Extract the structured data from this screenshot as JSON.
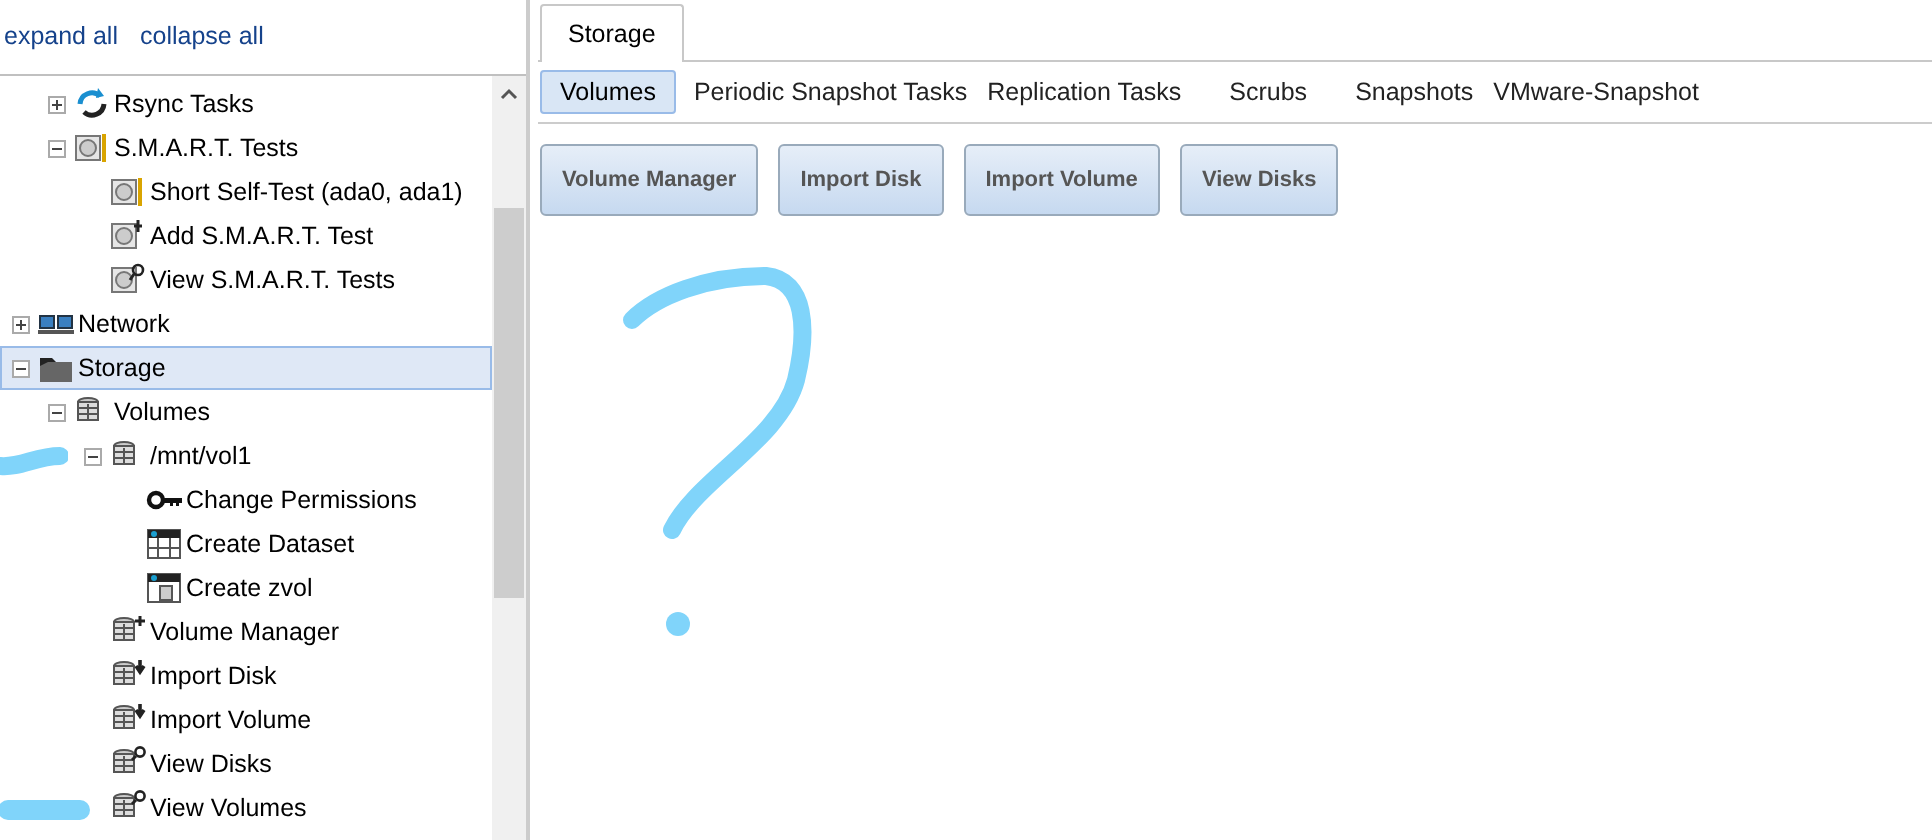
{
  "tree_links": [
    "expand all",
    "collapse all"
  ],
  "tree": {
    "partial_branch": [
      {
        "label": "Rsync Tasks",
        "kind": "sync",
        "expanded": false,
        "selected": false
      },
      {
        "label": "S.M.A.R.T. Tests",
        "kind": "disk",
        "expanded": true,
        "selected": false,
        "children": [
          {
            "label": "Short Self-Test (ada0, ada1)",
            "kind": "disk",
            "selected": false
          },
          {
            "label": "Add S.M.A.R.T. Test",
            "kind": "disk-add",
            "selected": false
          },
          {
            "label": "View S.M.A.R.T. Tests",
            "kind": "disk-view",
            "selected": false
          }
        ]
      }
    ],
    "items": [
      {
        "label": "Network",
        "kind": "network",
        "expanded": false,
        "selected": false
      },
      {
        "label": "Storage",
        "kind": "folder",
        "expanded": true,
        "selected": true,
        "children": [
          {
            "label": "Volumes",
            "kind": "volume",
            "expanded": true,
            "selected": false,
            "children": [
              {
                "label": "/mnt/vol1",
                "kind": "volume",
                "expanded": true,
                "selected": false,
                "children": [
                  {
                    "label": "Change Permissions",
                    "kind": "key",
                    "selected": false
                  },
                  {
                    "label": "Create Dataset",
                    "kind": "grid",
                    "selected": false
                  },
                  {
                    "label": "Create zvol",
                    "kind": "grid-volume",
                    "selected": false
                  }
                ]
              },
              {
                "label": "Volume Manager",
                "kind": "volume-add",
                "selected": false
              },
              {
                "label": "Import Disk",
                "kind": "volume-import",
                "selected": false
              },
              {
                "label": "Import Volume",
                "kind": "volume-import",
                "selected": false
              },
              {
                "label": "View Disks",
                "kind": "volume-view",
                "selected": false
              },
              {
                "label": "View Volumes",
                "kind": "volume-view",
                "selected": false
              }
            ]
          }
        ]
      }
    ]
  },
  "main_tabs": [
    {
      "label": "Storage",
      "selected": true
    }
  ],
  "sub_tabs": [
    {
      "label": "Volumes",
      "selected": true
    },
    {
      "label": "Periodic Snapshot Tasks",
      "selected": false
    },
    {
      "label": "Replication Tasks",
      "selected": false
    },
    {
      "label": "Scrubs",
      "selected": false
    },
    {
      "label": "Snapshots",
      "selected": false
    },
    {
      "label": "VMware-Snapshot",
      "selected": false
    }
  ],
  "buttons": [
    "Volume Manager",
    "Import Disk",
    "Import Volume",
    "View Disks"
  ]
}
